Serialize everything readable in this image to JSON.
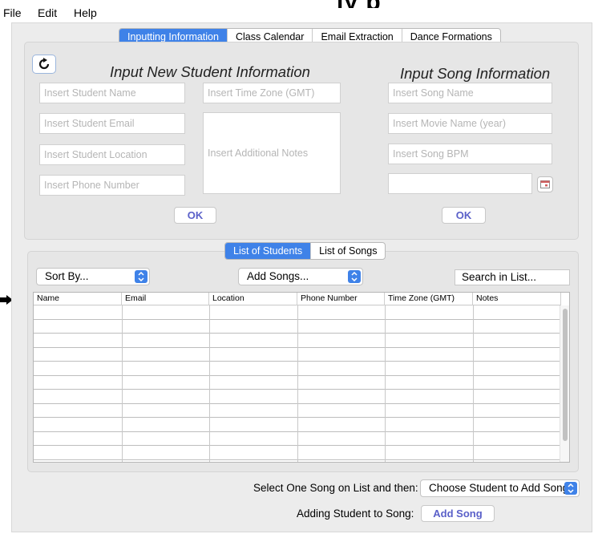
{
  "menu": [
    "File",
    "Edit",
    "Help"
  ],
  "title_fragment": "ly p",
  "main_tabs": [
    {
      "label": "Inputting Information",
      "active": true
    },
    {
      "label": "Class Calendar",
      "active": false
    },
    {
      "label": "Email Extraction",
      "active": false
    },
    {
      "label": "Dance Formations",
      "active": false
    }
  ],
  "student_form": {
    "heading": "Input New Student Information",
    "name_placeholder": "Insert Student Name",
    "email_placeholder": "Insert Student Email",
    "location_placeholder": "Insert Student Location",
    "phone_placeholder": "Insert Phone Number",
    "timezone_placeholder": "Insert Time Zone (GMT)",
    "notes_placeholder": "Insert Additional Notes",
    "ok_label": "OK"
  },
  "song_form": {
    "heading": "Input Song Information",
    "song_placeholder": "Insert Song Name",
    "movie_placeholder": "Insert Movie Name (year)",
    "bpm_placeholder": "Insert Song BPM",
    "date_value": "",
    "ok_label": "OK"
  },
  "list_tabs": [
    {
      "label": "List of Students",
      "active": true
    },
    {
      "label": "List of Songs",
      "active": false
    }
  ],
  "sort_select": "Sort By...",
  "add_songs_select": "Add Songs...",
  "search_placeholder": "Search in List...",
  "table": {
    "columns": [
      "Name",
      "Email",
      "Location",
      "Phone Number",
      "Time Zone (GMT)",
      "Notes"
    ],
    "rows": []
  },
  "footer": {
    "select_one_label": "Select One Song on List and then:",
    "choose_student_select": "Choose Student to Add Song",
    "adding_label": "Adding Student to Song:",
    "add_song_label": "Add Song"
  },
  "colors": {
    "accent": "#3f82e8",
    "button_text": "#5a60c9"
  }
}
